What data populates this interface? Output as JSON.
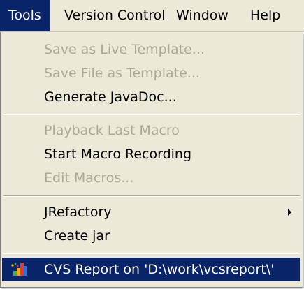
{
  "menubar": {
    "items": [
      {
        "label": "Tools",
        "active": true
      },
      {
        "label": "Version Control",
        "active": false
      },
      {
        "label": "Window",
        "active": false
      },
      {
        "label": "Help",
        "active": false
      }
    ]
  },
  "tools_menu": {
    "items": [
      {
        "label": "Save as Live Template...",
        "disabled": true
      },
      {
        "label": "Save File as Template...",
        "disabled": true
      },
      {
        "label": "Generate JavaDoc...",
        "disabled": false
      },
      {
        "label": "Playback Last Macro",
        "disabled": true
      },
      {
        "label": "Start Macro Recording",
        "disabled": false
      },
      {
        "label": "Edit Macros...",
        "disabled": true
      },
      {
        "label": "JRefactory",
        "disabled": false,
        "has_submenu": true
      },
      {
        "label": "Create jar",
        "disabled": false
      },
      {
        "label": "CVS Report on 'D:\\work\\vcsreport\\'",
        "disabled": false,
        "highlighted": true,
        "icon": "cvs-report-icon"
      }
    ]
  },
  "colors": {
    "menu_background": "#ece9d8",
    "selection": "#0a246a",
    "disabled_text": "#aca899"
  }
}
